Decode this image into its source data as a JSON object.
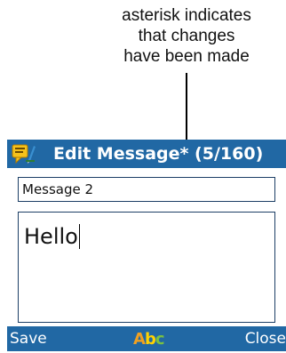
{
  "annotation": {
    "lines": [
      "asterisk indicates",
      "that changes",
      "have been made"
    ]
  },
  "window": {
    "title": "Edit Message* (5/160)",
    "icon": "message-edit-icon"
  },
  "subject": {
    "value": "Message 2"
  },
  "message_body": {
    "value": "Hello"
  },
  "softkeys": {
    "left_label": "Save",
    "center_icon": "spell-check-icon",
    "center_glyphs": [
      "A",
      "b",
      "c"
    ],
    "right_label": "Close"
  },
  "colors": {
    "bar_background": "#2168a4",
    "bar_text": "#ffffff",
    "field_border": "#1d3f66"
  }
}
